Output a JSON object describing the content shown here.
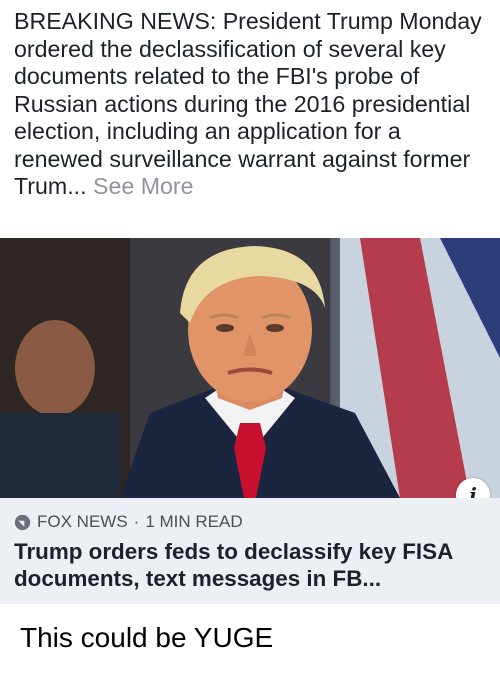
{
  "post": {
    "text": "BREAKING NEWS: President Trump Monday ordered the declassification of several key documents related to the FBI's probe of Russian actions during the 2016 presidential election, including an application for a renewed surveillance warrant against former Trum...",
    "see_more": "See More"
  },
  "link_card": {
    "source": "FOX NEWS",
    "separator": "·",
    "read_time": "1 MIN READ",
    "headline": "Trump orders feds to declassify key FISA documents, text messages in FB...",
    "info_icon": "i"
  },
  "comment": {
    "text": "This could be YUGE"
  }
}
